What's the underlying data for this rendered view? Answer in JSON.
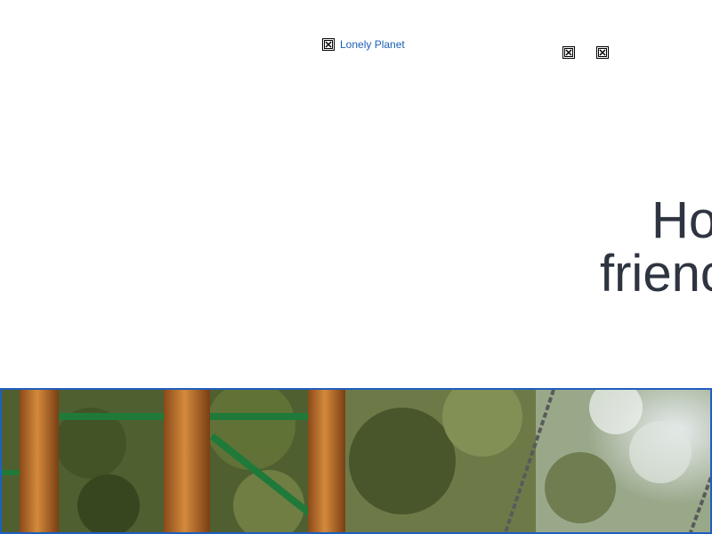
{
  "header": {
    "logo_alt": "Lonely Planet",
    "icons": [
      "broken-image-icon",
      "broken-image-icon",
      "broken-image-icon"
    ]
  },
  "hero_title": {
    "line1": "Ho",
    "line2": "frienc"
  },
  "colors": {
    "link": "#1a5fb4",
    "headline": "#2e3440",
    "hero_border": "#1f5fbf"
  }
}
